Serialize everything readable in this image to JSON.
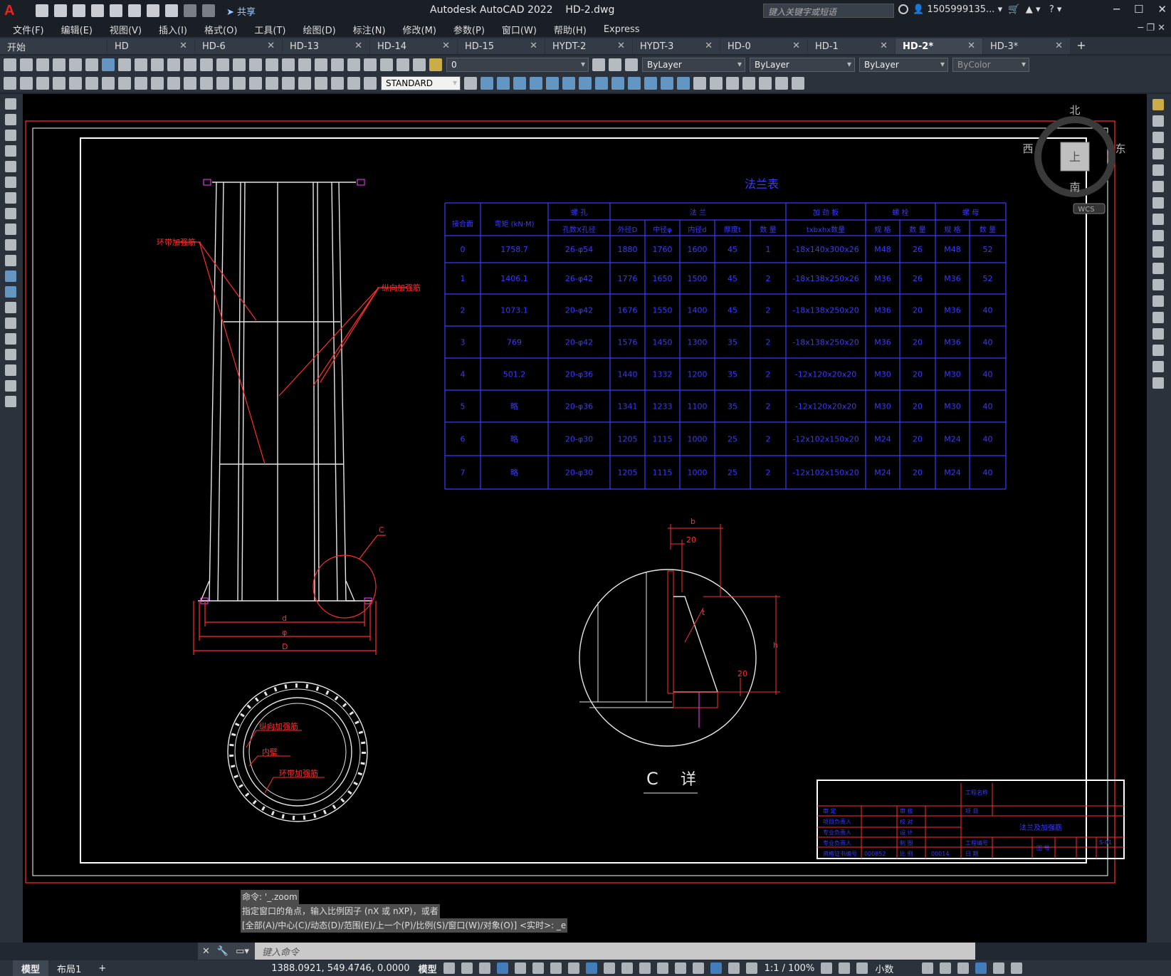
{
  "app": {
    "logo": "A",
    "share_label": "共享",
    "title": "Autodesk AutoCAD 2022",
    "file": "HD-2.dwg",
    "search_placeholder": "键入关键字或短语",
    "user": "1505999135..."
  },
  "menu": [
    "文件(F)",
    "编辑(E)",
    "视图(V)",
    "插入(I)",
    "格式(O)",
    "工具(T)",
    "绘图(D)",
    "标注(N)",
    "修改(M)",
    "参数(P)",
    "窗口(W)",
    "帮助(H)",
    "Express"
  ],
  "tabs": [
    "开始",
    "HD",
    "HD-6",
    "HD-13",
    "HD-14",
    "HD-15",
    "HYDT-2",
    "HYDT-3",
    "HD-0",
    "HD-1",
    "HD-2*",
    "HD-3*"
  ],
  "active_tab": "HD-2*",
  "toolbar": {
    "layer": "0",
    "color": "ByLayer",
    "linetype": "ByLayer",
    "lineweight": "ByLayer",
    "plotstyle": "ByColor",
    "textstyle": "STANDARD"
  },
  "viewcube": {
    "north": "北",
    "south": "南",
    "east": "东",
    "west": "西",
    "top": "上",
    "wcs": "WCS"
  },
  "drawing": {
    "table_title": "法兰表",
    "headers": [
      "接合面",
      "弯矩 (kN·M)",
      "螺 孔",
      "法 兰",
      "加 劲 板",
      "螺 栓",
      "螺 母"
    ],
    "subheaders": [
      "孔数X孔径",
      "外径D",
      "中径φ",
      "内径d",
      "厚度t",
      "数 量",
      "txbxhx数量",
      "规 格",
      "数 量",
      "规 格",
      "数 量"
    ],
    "rows": [
      [
        "0",
        "1758.7",
        "26-φ54",
        "1880",
        "1760",
        "1600",
        "45",
        "1",
        "-18x140x300x26",
        "M48",
        "26",
        "M48",
        "52"
      ],
      [
        "1",
        "1406.1",
        "26-φ42",
        "1776",
        "1650",
        "1500",
        "45",
        "2",
        "-18x138x250x26",
        "M36",
        "26",
        "M36",
        "52"
      ],
      [
        "2",
        "1073.1",
        "20-φ42",
        "1676",
        "1550",
        "1400",
        "45",
        "2",
        "-18x138x250x20",
        "M36",
        "20",
        "M36",
        "40"
      ],
      [
        "3",
        "769",
        "20-φ42",
        "1576",
        "1450",
        "1300",
        "35",
        "2",
        "-18x138x250x20",
        "M36",
        "20",
        "M36",
        "40"
      ],
      [
        "4",
        "501.2",
        "20-φ36",
        "1440",
        "1332",
        "1200",
        "35",
        "2",
        "-12x120x20x20",
        "M30",
        "20",
        "M30",
        "40"
      ],
      [
        "5",
        "略",
        "20-φ36",
        "1341",
        "1233",
        "1100",
        "35",
        "2",
        "-12x120x20x20",
        "M30",
        "20",
        "M30",
        "40"
      ],
      [
        "6",
        "略",
        "20-φ30",
        "1205",
        "1115",
        "1000",
        "25",
        "2",
        "-12x102x150x20",
        "M24",
        "20",
        "M24",
        "40"
      ],
      [
        "7",
        "略",
        "20-φ30",
        "1205",
        "1115",
        "1000",
        "25",
        "2",
        "-12x102x150x20",
        "M24",
        "20",
        "M24",
        "40"
      ]
    ],
    "labels": {
      "ring_stiffener": "环带加强筋",
      "long_stiffener": "纵向加强筋",
      "inner_wall": "内壁",
      "detail_c": "C",
      "dim_d": "d",
      "dim_phi": "φ",
      "dim_D": "D",
      "dim_b": "b",
      "dim_20a": "20",
      "dim_20b": "20",
      "dim_h": "h",
      "dim_t": "t",
      "detail_title_c": "C",
      "detail_title_word": "详",
      "title_block_name": "法兰及加强筋"
    },
    "title_block": {
      "project_label": "工程名称",
      "item_label": "项 目",
      "chief_engineer": "审 定",
      "reviewer": "审 核",
      "project_leader": "项目负责人",
      "checker": "校 对",
      "pro_leader": "专业负责人",
      "design": "设 计",
      "draw": "制 图",
      "company": "工程编号",
      "scale": "比 例",
      "date": "日 期",
      "sheet": "图 号",
      "code": "S-01",
      "cert": "资格证书编号",
      "cert_no": "000852",
      "cert_no2": "00014"
    }
  },
  "command": {
    "history": [
      "命令: '_.zoom",
      "指定窗口的角点，输入比例因子 (nX 或 nXP)，或者",
      "[全部(A)/中心(C)/动态(D)/范围(E)/上一个(P)/比例(S)/窗口(W)/对象(O)] <实时>: _e"
    ],
    "placeholder": "键入命令"
  },
  "status": {
    "layouts": [
      "模型",
      "布局1"
    ],
    "coords": "1388.0921, 549.4746, 0.0000",
    "space": "模型",
    "scale": "1:1 / 100%",
    "units": "小数"
  }
}
